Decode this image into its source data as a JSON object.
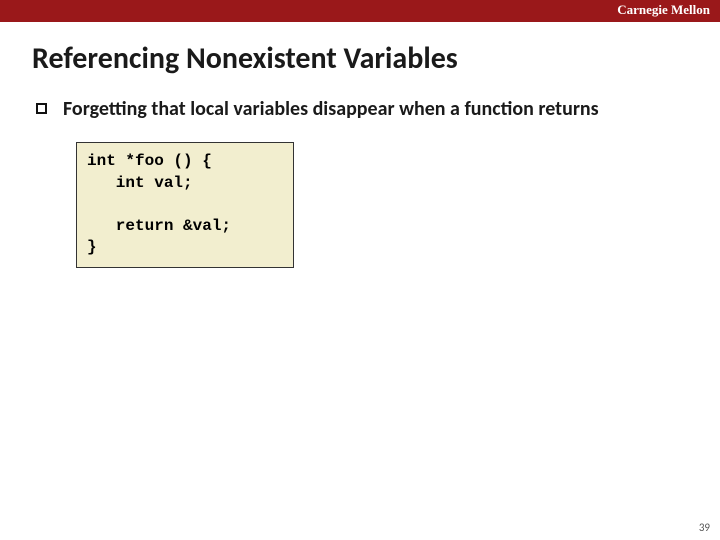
{
  "header": {
    "brand": "Carnegie Mellon"
  },
  "slide": {
    "title": "Referencing Nonexistent Variables",
    "bullet_text": "Forgetting that local variables disappear when a function returns",
    "code": "int *foo () {\n   int val;\n\n   return &val;\n}"
  },
  "footer": {
    "page_number": "39"
  }
}
